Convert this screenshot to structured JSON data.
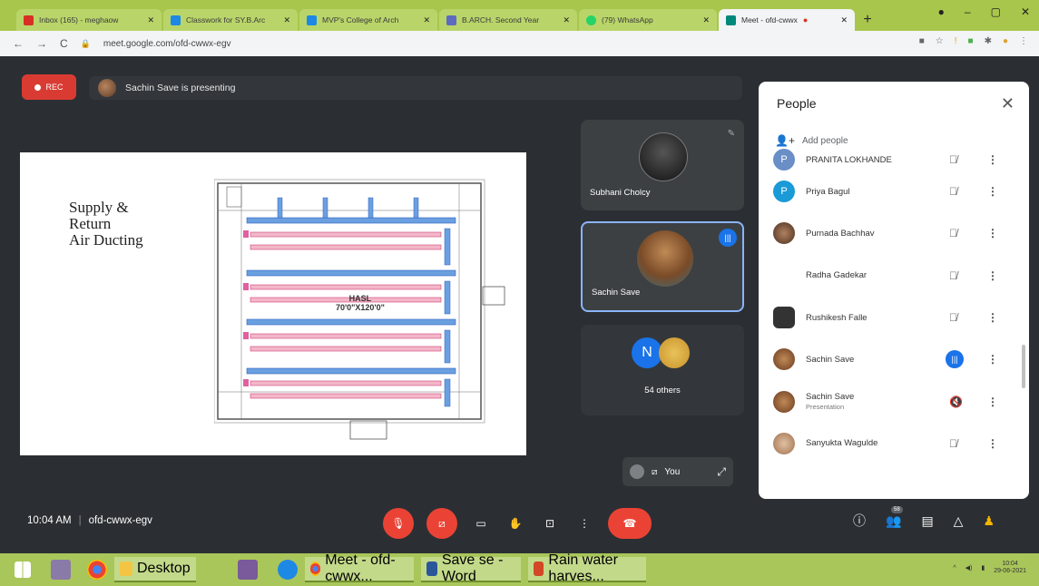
{
  "browser": {
    "tabs": [
      {
        "label": "Inbox (165) - meghaow",
        "color": "#d93025"
      },
      {
        "label": "Classwork for SY.B.Arc",
        "color": "#1e88e5"
      },
      {
        "label": "MVP's College of Arch",
        "color": "#1e88e5"
      },
      {
        "label": "B.ARCH. Second Year",
        "color": "#5c6bc0"
      },
      {
        "label": "(79) WhatsApp",
        "color": "#25d366"
      },
      {
        "label": "Meet - ofd-cwwx",
        "color": "#00897b"
      }
    ],
    "url": "meet.google.com/ofd-cwwx-egv"
  },
  "banner": {
    "rec_label": "REC",
    "presenting": "Sachin Save is presenting"
  },
  "slide": {
    "title": "Supply &\nReturn\nAir Ducting",
    "plan_label_1": "HASL",
    "plan_label_2": "70'0\"X120'0\""
  },
  "tiles": {
    "t1_name": "Subhani Cholcy",
    "t2_name": "Sachin Save",
    "others_initial": "N",
    "others_label": "54 others",
    "self_label": "You"
  },
  "people": {
    "title": "People",
    "add_people": "Add people",
    "rows": [
      {
        "name": "PRANITA LOKHANDE",
        "sub": "",
        "initial": "P",
        "color": "#6a8ec6",
        "mic": "off"
      },
      {
        "name": "Priya Bagul",
        "sub": "",
        "initial": "P",
        "color": "#1a9ad6",
        "mic": "off"
      },
      {
        "name": "Purnada Bachhav",
        "sub": "",
        "initial": "",
        "color": "#6b4a3a",
        "mic": "off"
      },
      {
        "name": "Radha Gadekar",
        "sub": "",
        "initial": "",
        "color": "#ffffff",
        "mic": "off"
      },
      {
        "name": "Rushikesh Falle",
        "sub": "",
        "initial": "",
        "color": "#333333",
        "mic": "off"
      },
      {
        "name": "Sachin Save",
        "sub": "",
        "initial": "",
        "color": "#b0744a",
        "mic": "on"
      },
      {
        "name": "Sachin Save",
        "sub": "Presentation",
        "initial": "",
        "color": "#b0744a",
        "mic": "present"
      },
      {
        "name": "Sanyukta Wagulde",
        "sub": "",
        "initial": "",
        "color": "#c9a27a",
        "mic": "off"
      }
    ]
  },
  "meeting": {
    "time": "10:04 AM",
    "code": "ofd-cwwx-egv",
    "people_count": "58"
  },
  "taskbar": {
    "desktop": "Desktop",
    "meet": "Meet - ofd-cwwx...",
    "word": "Save se - Word",
    "ppt": "Rain water harves...",
    "time": "10:04",
    "date": "29-06-2021"
  }
}
